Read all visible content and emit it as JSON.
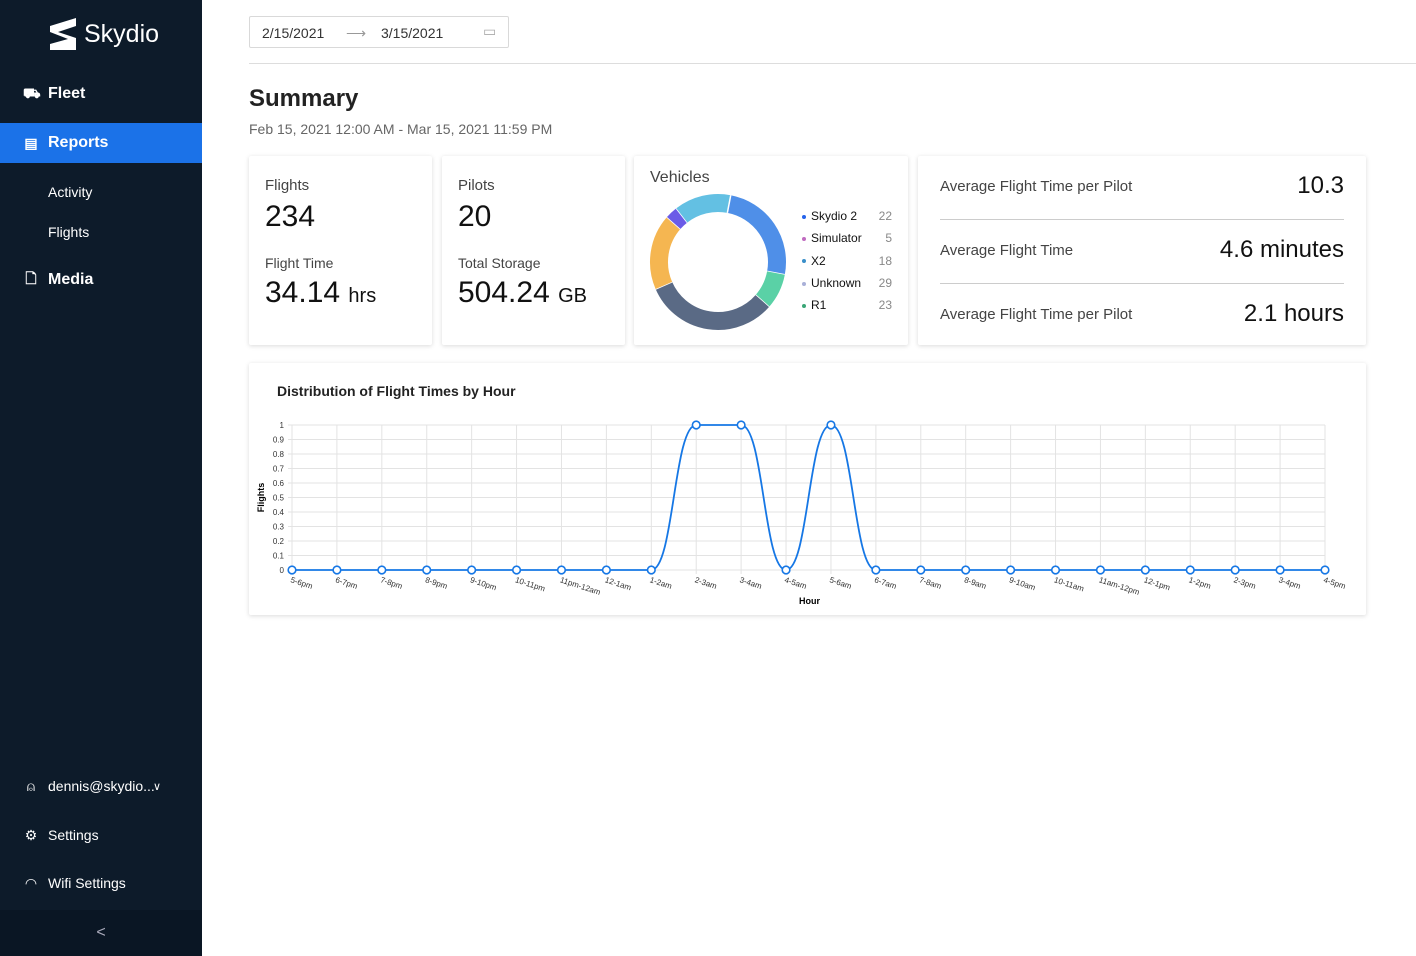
{
  "sidebar": {
    "brand": "Skydio",
    "items": [
      {
        "label": "Fleet",
        "icon": "vehicle-icon"
      },
      {
        "label": "Reports",
        "icon": "report-icon",
        "active": true
      },
      {
        "label": "Activity"
      },
      {
        "label": "Flights"
      },
      {
        "label": "Media",
        "icon": "file-icon"
      }
    ],
    "user": "dennis@skydio...",
    "settings": "Settings",
    "wifi": "Wifi Settings",
    "collapse": "<"
  },
  "date_range": {
    "start": "2/15/2021",
    "end": "3/15/2021"
  },
  "summary": {
    "title": "Summary",
    "range": "Feb 15, 2021 12:00 AM - Mar 15, 2021 11:59 PM"
  },
  "flights_card": {
    "label": "Flights",
    "value": "234",
    "sub_label": "Flight Time",
    "sub_value": "34.14",
    "sub_unit": "hrs"
  },
  "pilots_card": {
    "label": "Pilots",
    "value": "20",
    "sub_label": "Total Storage",
    "sub_value": "504.24",
    "sub_unit": "GB"
  },
  "vehicles_card": {
    "label": "Vehicles",
    "legend": [
      {
        "name": "Skydio 2",
        "value": "22",
        "color": "#2563eb"
      },
      {
        "name": "Simulator",
        "value": "5",
        "color": "#c06bc0"
      },
      {
        "name": "X2",
        "value": "18",
        "color": "#3a8fc9"
      },
      {
        "name": "Unknown",
        "value": "29",
        "color": "#a9b0d8"
      },
      {
        "name": "R1",
        "value": "23",
        "color": "#3aa676"
      }
    ],
    "donut_segments": [
      {
        "fraction": 0.25,
        "color": "#4f8fe8"
      },
      {
        "fraction": 0.085,
        "color": "#5ad1a6"
      },
      {
        "fraction": 0.32,
        "color": "#5a6a85"
      },
      {
        "fraction": 0.18,
        "color": "#f5b651"
      },
      {
        "fraction": 0.03,
        "color": "#6b5ce7"
      },
      {
        "fraction": 0.135,
        "color": "#63c0e3"
      }
    ]
  },
  "averages": [
    {
      "label": "Average Flight Time per Pilot",
      "value": "10.3"
    },
    {
      "label": "Average Flight Time",
      "value": "4.6 minutes"
    },
    {
      "label": "Average Flight Time per Pilot",
      "value": "2.1 hours"
    }
  ],
  "chart_data": {
    "type": "line",
    "title": "Distribution of Flight Times by Hour",
    "xlabel": "Hour",
    "ylabel": "Flights",
    "ylim": [
      0,
      1
    ],
    "yticks": [
      "0",
      "0.1",
      "0.2",
      "0.3",
      "0.4",
      "0.5",
      "0.6",
      "0.7",
      "0.8",
      "0.9",
      "1"
    ],
    "categories": [
      "5-6pm",
      "6-7pm",
      "7-8pm",
      "8-9pm",
      "9-10pm",
      "10-11pm",
      "11pm-12am",
      "12-1am",
      "1-2am",
      "2-3am",
      "3-4am",
      "4-5am",
      "5-6am",
      "6-7am",
      "7-8am",
      "8-9am",
      "9-10am",
      "10-11am",
      "11am-12pm",
      "12-1pm",
      "1-2pm",
      "2-3pm",
      "3-4pm",
      "4-5pm"
    ],
    "values": [
      0,
      0,
      0,
      0,
      0,
      0,
      0,
      0,
      0,
      1,
      1,
      0,
      1,
      0,
      0,
      0,
      0,
      0,
      0,
      0,
      0,
      0,
      0,
      0
    ],
    "grid": true,
    "color": "#1677e5"
  }
}
